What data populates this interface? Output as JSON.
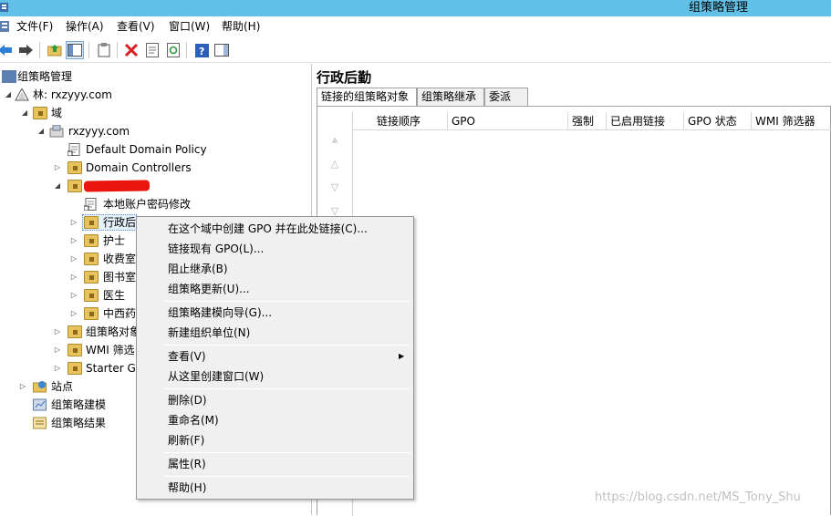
{
  "window": {
    "title": "组策略管理"
  },
  "menu": [
    "文件(F)",
    "操作(A)",
    "查看(V)",
    "窗口(W)",
    "帮助(H)"
  ],
  "tree": {
    "root": "组策略管理",
    "forest": "林: rxzyyy.com",
    "domains": "域",
    "domain": "rxzyyy.com",
    "default_policy": "Default Domain Policy",
    "domain_controllers": "Domain Controllers",
    "ou_child_policy": "本地账户密码修改",
    "ou_xingzheng": "行政后",
    "ou_hushi": "护士",
    "ou_shoufei": "收费室",
    "ou_tushu": "图书室",
    "ou_yisheng": "医生",
    "ou_zhongxi": "中西药",
    "gpo_objects": "组策略对象",
    "wmi_filters": "WMI 筛选",
    "starter_gpo": "Starter GP",
    "sites": "站点",
    "modeling": "组策略建模",
    "results": "组策略结果"
  },
  "right": {
    "title": "行政后勤",
    "tabs": [
      "链接的组策略对象",
      "组策略继承",
      "委派"
    ],
    "columns": [
      "链接顺序",
      "GPO",
      "强制",
      "已启用链接",
      "GPO 状态",
      "WMI 筛选器"
    ]
  },
  "context_menu": {
    "create_link": "在这个域中创建 GPO 并在此处链接(C)...",
    "link_existing": "链接现有 GPO(L)...",
    "block_inheritance": "阻止继承(B)",
    "gp_update": "组策略更新(U)...",
    "modeling_wizard": "组策略建模向导(G)...",
    "new_ou": "新建组织单位(N)",
    "view": "查看(V)",
    "new_window": "从这里创建窗口(W)",
    "delete": "删除(D)",
    "rename": "重命名(M)",
    "refresh": "刷新(F)",
    "properties": "属性(R)",
    "help": "帮助(H)"
  },
  "watermark": "https://blog.csdn.net/MS_Tony_Shu"
}
